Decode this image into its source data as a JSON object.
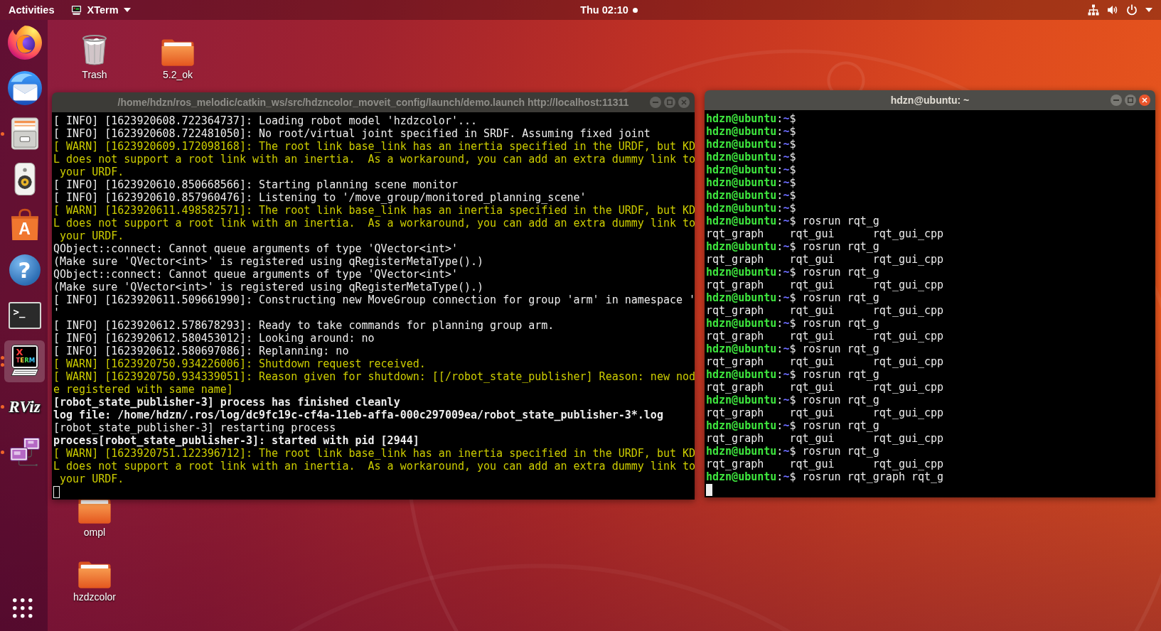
{
  "top_bar": {
    "activities": "Activities",
    "app_menu": "XTerm",
    "clock": "Thu 02:10",
    "notification": true
  },
  "dock": {
    "items": [
      {
        "kind": "browser",
        "running": false,
        "several_windows": false,
        "selected": false
      },
      {
        "kind": "mail",
        "running": false,
        "several_windows": false,
        "selected": false
      },
      {
        "kind": "files",
        "running": true,
        "several_windows": false,
        "selected": false
      },
      {
        "kind": "music",
        "running": false,
        "several_windows": false,
        "selected": false
      },
      {
        "kind": "store",
        "logo_text": [
          "A"
        ],
        "running": false,
        "several_windows": false,
        "selected": false
      },
      {
        "kind": "help",
        "logo_text": [
          "?"
        ],
        "running": false,
        "several_windows": false,
        "selected": false
      },
      {
        "kind": "terminal",
        "logo_text": [
          ">_"
        ],
        "running": false,
        "several_windows": false,
        "selected": false
      },
      {
        "kind": "xterm",
        "logo_text": [
          "X",
          "TERM"
        ],
        "running": true,
        "several_windows": true,
        "selected": true
      },
      {
        "kind": "viewer",
        "logo_text": [
          "RViz"
        ],
        "running": true,
        "several_windows": false,
        "selected": false
      },
      {
        "kind": "remote",
        "running": true,
        "several_windows": false,
        "selected": false
      }
    ]
  },
  "desktop_items": [
    {
      "kind": "trash",
      "label": "Trash"
    },
    {
      "kind": "folder",
      "label": "5.2_ok"
    },
    {
      "kind": "folder",
      "label": "ompl"
    },
    {
      "kind": "folder",
      "label": "hzdzcolor"
    }
  ],
  "windows": [
    {
      "title": "/home/hdzn/ros_melodic/catkin_ws/src/hdzncolor_moveit_config/launch/demo.launch http://localhost:11311",
      "active": false,
      "lines": [
        {
          "kind": "normal",
          "text": "[ INFO] [1623920608.722364737]: Loading robot model 'hzdzcolor'..."
        },
        {
          "kind": "normal",
          "text": "[ INFO] [1623920608.722481050]: No root/virtual joint specified in SRDF. Assuming fixed joint"
        },
        {
          "kind": "warning",
          "text": "[ WARN] [1623920609.172098168]: The root link base_link has an inertia specified in the URDF, but KDL does not support a root link with an inertia.  As a workaround, you can add an extra dummy link to your URDF."
        },
        {
          "kind": "normal",
          "text": "[ INFO] [1623920610.850668566]: Starting planning scene monitor"
        },
        {
          "kind": "normal",
          "text": "[ INFO] [1623920610.857960476]: Listening to '/move_group/monitored_planning_scene'"
        },
        {
          "kind": "warning",
          "text": "[ WARN] [1623920611.498582571]: The root link base_link has an inertia specified in the URDF, but KDL does not support a root link with an inertia.  As a workaround, you can add an extra dummy link to your URDF."
        },
        {
          "kind": "normal",
          "text": "QObject::connect: Cannot queue arguments of type 'QVector<int>'"
        },
        {
          "kind": "normal",
          "text": "(Make sure 'QVector<int>' is registered using qRegisterMetaType().)"
        },
        {
          "kind": "normal",
          "text": "QObject::connect: Cannot queue arguments of type 'QVector<int>'"
        },
        {
          "kind": "normal",
          "text": "(Make sure 'QVector<int>' is registered using qRegisterMetaType().)"
        },
        {
          "kind": "normal",
          "text": "[ INFO] [1623920611.509661990]: Constructing new MoveGroup connection for group 'arm' in namespace ''"
        },
        {
          "kind": "normal",
          "text": "[ INFO] [1623920612.578678293]: Ready to take commands for planning group arm."
        },
        {
          "kind": "normal",
          "text": "[ INFO] [1623920612.580453012]: Looking around: no"
        },
        {
          "kind": "normal",
          "text": "[ INFO] [1623920612.580697086]: Replanning: no"
        },
        {
          "kind": "warning",
          "text": "[ WARN] [1623920750.934226006]: Shutdown request received."
        },
        {
          "kind": "warning",
          "text": "[ WARN] [1623920750.934339051]: Reason given for shutdown: [[/robot_state_publisher] Reason: new node registered with same name]"
        },
        {
          "kind": "bold",
          "text": "[robot_state_publisher-3] process has finished cleanly"
        },
        {
          "kind": "bold",
          "text": "log file: /home/hdzn/.ros/log/dc9fc19c-cf4a-11eb-affa-000c297009ea/robot_state_publisher-3*.log"
        },
        {
          "kind": "normal",
          "text": "[robot_state_publisher-3] restarting process"
        },
        {
          "kind": "bold",
          "text": "process[robot_state_publisher-3]: started with pid [2944]"
        },
        {
          "kind": "warning",
          "text": "[ WARN] [1623920751.122396712]: The root link base_link has an inertia specified in the URDF, but KDL does not support a root link with an inertia.  As a workaround, you can add an extra dummy link to your URDF."
        }
      ]
    },
    {
      "title": "hdzn@ubuntu: ~",
      "active": true,
      "lines": [
        {
          "kind": "prompt",
          "user": "hdzn@ubuntu",
          "separator": ":",
          "path": "~",
          "symbol": "$"
        },
        {
          "kind": "prompt",
          "user": "hdzn@ubuntu",
          "separator": ":",
          "path": "~",
          "symbol": "$"
        },
        {
          "kind": "prompt",
          "user": "hdzn@ubuntu",
          "separator": ":",
          "path": "~",
          "symbol": "$"
        },
        {
          "kind": "prompt",
          "user": "hdzn@ubuntu",
          "separator": ":",
          "path": "~",
          "symbol": "$"
        },
        {
          "kind": "prompt",
          "user": "hdzn@ubuntu",
          "separator": ":",
          "path": "~",
          "symbol": "$"
        },
        {
          "kind": "prompt",
          "user": "hdzn@ubuntu",
          "separator": ":",
          "path": "~",
          "symbol": "$"
        },
        {
          "kind": "prompt",
          "user": "hdzn@ubuntu",
          "separator": ":",
          "path": "~",
          "symbol": "$"
        },
        {
          "kind": "prompt",
          "user": "hdzn@ubuntu",
          "separator": ":",
          "path": "~",
          "symbol": "$"
        },
        {
          "kind": "prompt",
          "user": "hdzn@ubuntu",
          "separator": ":",
          "path": "~",
          "symbol": "$",
          "command": "rosrun rqt_g"
        },
        {
          "kind": "output",
          "text": "rqt_graph    rqt_gui      rqt_gui_cpp"
        },
        {
          "kind": "prompt",
          "user": "hdzn@ubuntu",
          "separator": ":",
          "path": "~",
          "symbol": "$",
          "command": "rosrun rqt_g"
        },
        {
          "kind": "output",
          "text": "rqt_graph    rqt_gui      rqt_gui_cpp"
        },
        {
          "kind": "prompt",
          "user": "hdzn@ubuntu",
          "separator": ":",
          "path": "~",
          "symbol": "$",
          "command": "rosrun rqt_g"
        },
        {
          "kind": "output",
          "text": "rqt_graph    rqt_gui      rqt_gui_cpp"
        },
        {
          "kind": "prompt",
          "user": "hdzn@ubuntu",
          "separator": ":",
          "path": "~",
          "symbol": "$",
          "command": "rosrun rqt_g"
        },
        {
          "kind": "output",
          "text": "rqt_graph    rqt_gui      rqt_gui_cpp"
        },
        {
          "kind": "prompt",
          "user": "hdzn@ubuntu",
          "separator": ":",
          "path": "~",
          "symbol": "$",
          "command": "rosrun rqt_g"
        },
        {
          "kind": "output",
          "text": "rqt_graph    rqt_gui      rqt_gui_cpp"
        },
        {
          "kind": "prompt",
          "user": "hdzn@ubuntu",
          "separator": ":",
          "path": "~",
          "symbol": "$",
          "command": "rosrun rqt_g"
        },
        {
          "kind": "output",
          "text": "rqt_graph    rqt_gui      rqt_gui_cpp"
        },
        {
          "kind": "prompt",
          "user": "hdzn@ubuntu",
          "separator": ":",
          "path": "~",
          "symbol": "$",
          "command": "rosrun rqt_g"
        },
        {
          "kind": "output",
          "text": "rqt_graph    rqt_gui      rqt_gui_cpp"
        },
        {
          "kind": "prompt",
          "user": "hdzn@ubuntu",
          "separator": ":",
          "path": "~",
          "symbol": "$",
          "command": "rosrun rqt_g"
        },
        {
          "kind": "output",
          "text": "rqt_graph    rqt_gui      rqt_gui_cpp"
        },
        {
          "kind": "prompt",
          "user": "hdzn@ubuntu",
          "separator": ":",
          "path": "~",
          "symbol": "$",
          "command": "rosrun rqt_g"
        },
        {
          "kind": "output",
          "text": "rqt_graph    rqt_gui      rqt_gui_cpp"
        },
        {
          "kind": "prompt",
          "user": "hdzn@ubuntu",
          "separator": ":",
          "path": "~",
          "symbol": "$",
          "command": "rosrun rqt_g"
        },
        {
          "kind": "output",
          "text": "rqt_graph    rqt_gui      rqt_gui_cpp"
        },
        {
          "kind": "prompt",
          "user": "hdzn@ubuntu",
          "separator": ":",
          "path": "~",
          "symbol": "$",
          "command": "rosrun rqt_graph rqt_g"
        }
      ]
    }
  ]
}
